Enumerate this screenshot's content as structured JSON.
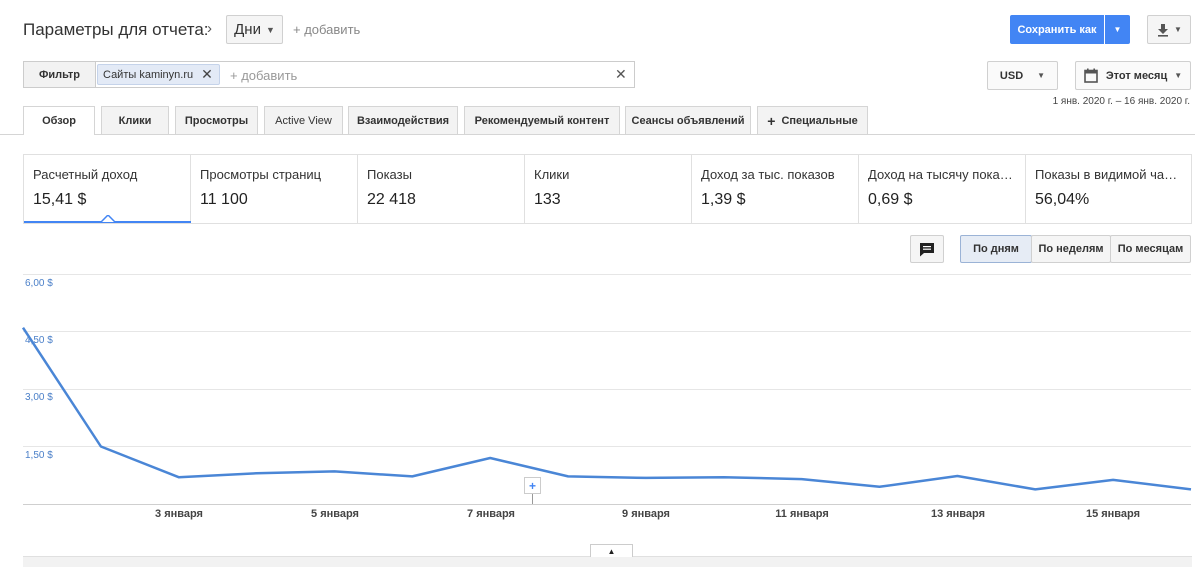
{
  "header": {
    "title": "Параметры для отчета:",
    "dimension_value": "Дни",
    "add_label": "+ добавить",
    "save_label": "Сохранить как"
  },
  "filter": {
    "label": "Фильтр",
    "chip_label": "Сайты kaminyn.ru",
    "add_placeholder": "+ добавить"
  },
  "currency": "USD",
  "period": {
    "label": "Этот месяц",
    "range": "1 янв. 2020 г. – 16 янв. 2020 г."
  },
  "tabs": [
    {
      "label": "Обзор"
    },
    {
      "label": "Клики"
    },
    {
      "label": "Просмотры"
    },
    {
      "label": "Active View"
    },
    {
      "label": "Взаимодействия"
    },
    {
      "label": "Рекомендуемый контент"
    },
    {
      "label": "Сеансы объявлений"
    },
    {
      "label": "Специальные"
    }
  ],
  "metrics": [
    {
      "label": "Расчетный доход",
      "value": "15,41 $"
    },
    {
      "label": "Просмотры страниц",
      "value": "11 100"
    },
    {
      "label": "Показы",
      "value": "22 418"
    },
    {
      "label": "Клики",
      "value": "133"
    },
    {
      "label": "Доход за тыс. показов",
      "value": "1,39 $"
    },
    {
      "label": "Доход на тысячу пока…",
      "value": "0,69 $"
    },
    {
      "label": "Показы в видимой ча…",
      "value": "56,04%"
    }
  ],
  "granularity": [
    "По дням",
    "По неделям",
    "По месяцам"
  ],
  "colors": {
    "accent": "#4285f4",
    "line": "#4a86d6"
  },
  "chart_data": {
    "type": "line",
    "x_labels": [
      "3 января",
      "5 января",
      "7 января",
      "9 января",
      "11 января",
      "13 января",
      "15 января"
    ],
    "y_ticks": [
      "6,00 $",
      "4,50 $",
      "3,00 $",
      "1,50 $"
    ],
    "ylim": [
      0,
      6
    ],
    "x": [
      1,
      2,
      3,
      4,
      5,
      6,
      7,
      8,
      9,
      10,
      11,
      12,
      13,
      14,
      15,
      16
    ],
    "values": [
      4.6,
      1.5,
      0.7,
      0.8,
      0.85,
      0.72,
      1.2,
      0.72,
      0.68,
      0.7,
      0.65,
      0.45,
      0.73,
      0.38,
      0.63,
      0.38
    ],
    "grid": true
  }
}
